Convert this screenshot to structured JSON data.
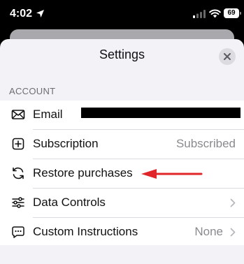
{
  "status_bar": {
    "time": "4:02",
    "battery": "69",
    "icons": [
      "location-arrow-icon",
      "signal-icon",
      "wifi-icon",
      "battery-icon"
    ]
  },
  "sheet": {
    "title": "Settings",
    "close_icon": "close-icon"
  },
  "account": {
    "section_header": "ACCOUNT",
    "rows": [
      {
        "icon": "envelope-icon",
        "label": "Email",
        "value": ""
      },
      {
        "icon": "plus-square-icon",
        "label": "Subscription",
        "value": "Subscribed"
      },
      {
        "icon": "refresh-icon",
        "label": "Restore purchases",
        "value": ""
      },
      {
        "icon": "sliders-icon",
        "label": "Data Controls",
        "value": ""
      },
      {
        "icon": "chat-bubble-icon",
        "label": "Custom Instructions",
        "value": "None"
      }
    ]
  },
  "colors": {
    "sheet_background": "#f2f2f7",
    "annotation_arrow": "#e0262a",
    "secondary_text": "#8a8a8e"
  }
}
